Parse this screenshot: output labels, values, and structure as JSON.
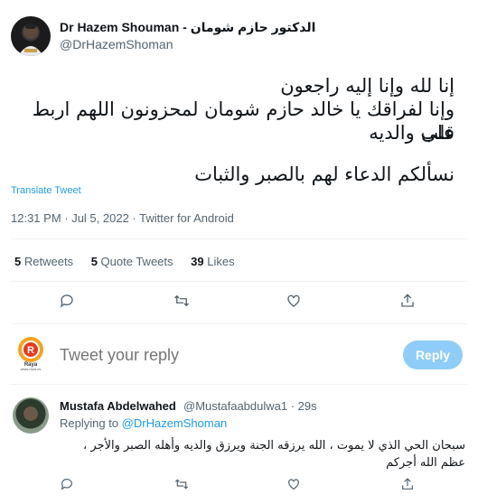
{
  "tweet": {
    "author_name": "Dr Hazem Shouman - الدكتور حازم شومان",
    "author_handle": "@DrHazemShoman",
    "text_lines": [
      "إنا لله وإنا إليه راجعون",
      "وإنا لفراقك يا خالد حازم شومان لمحزونون اللهم اربط على",
      "قلب والديه",
      "نسألكم الدعاء لهم بالصبر والثبات"
    ],
    "translate_label": "Translate Tweet",
    "timestamp": "12:31 PM · Jul 5, 2022 · Twitter for Android"
  },
  "stats": {
    "retweets_count": "5",
    "retweets_label": "Retweets",
    "quote_count": "5",
    "quote_label": "Quote Tweets",
    "likes_count": "39",
    "likes_label": "Likes"
  },
  "compose": {
    "placeholder": "Tweet your reply",
    "reply_button": "Reply",
    "avatar_logo_text": "Raya",
    "avatar_logo_sub": "www.raya.ps"
  },
  "reply": {
    "author_name": "Mustafa Abdelwahed",
    "author_handle": "@Mustafaabdulwa1 · 29s",
    "replying_prefix": "Replying to",
    "replying_to": "@DrHazemShoman",
    "text_lines": [
      "سبحان الحي الذي لا يموت ، الله يرزقه الجنة ويرزق والديه وأهله الصبر والأجر ،",
      "عظم الله أجركم"
    ]
  },
  "colors": {
    "accent": "#1d9bf0",
    "reply_button_disabled": "#8ecdf8",
    "muted_text": "#536471",
    "divider": "#eff3f4"
  },
  "icons": [
    "reply-icon",
    "retweet-icon",
    "like-icon",
    "share-icon"
  ]
}
